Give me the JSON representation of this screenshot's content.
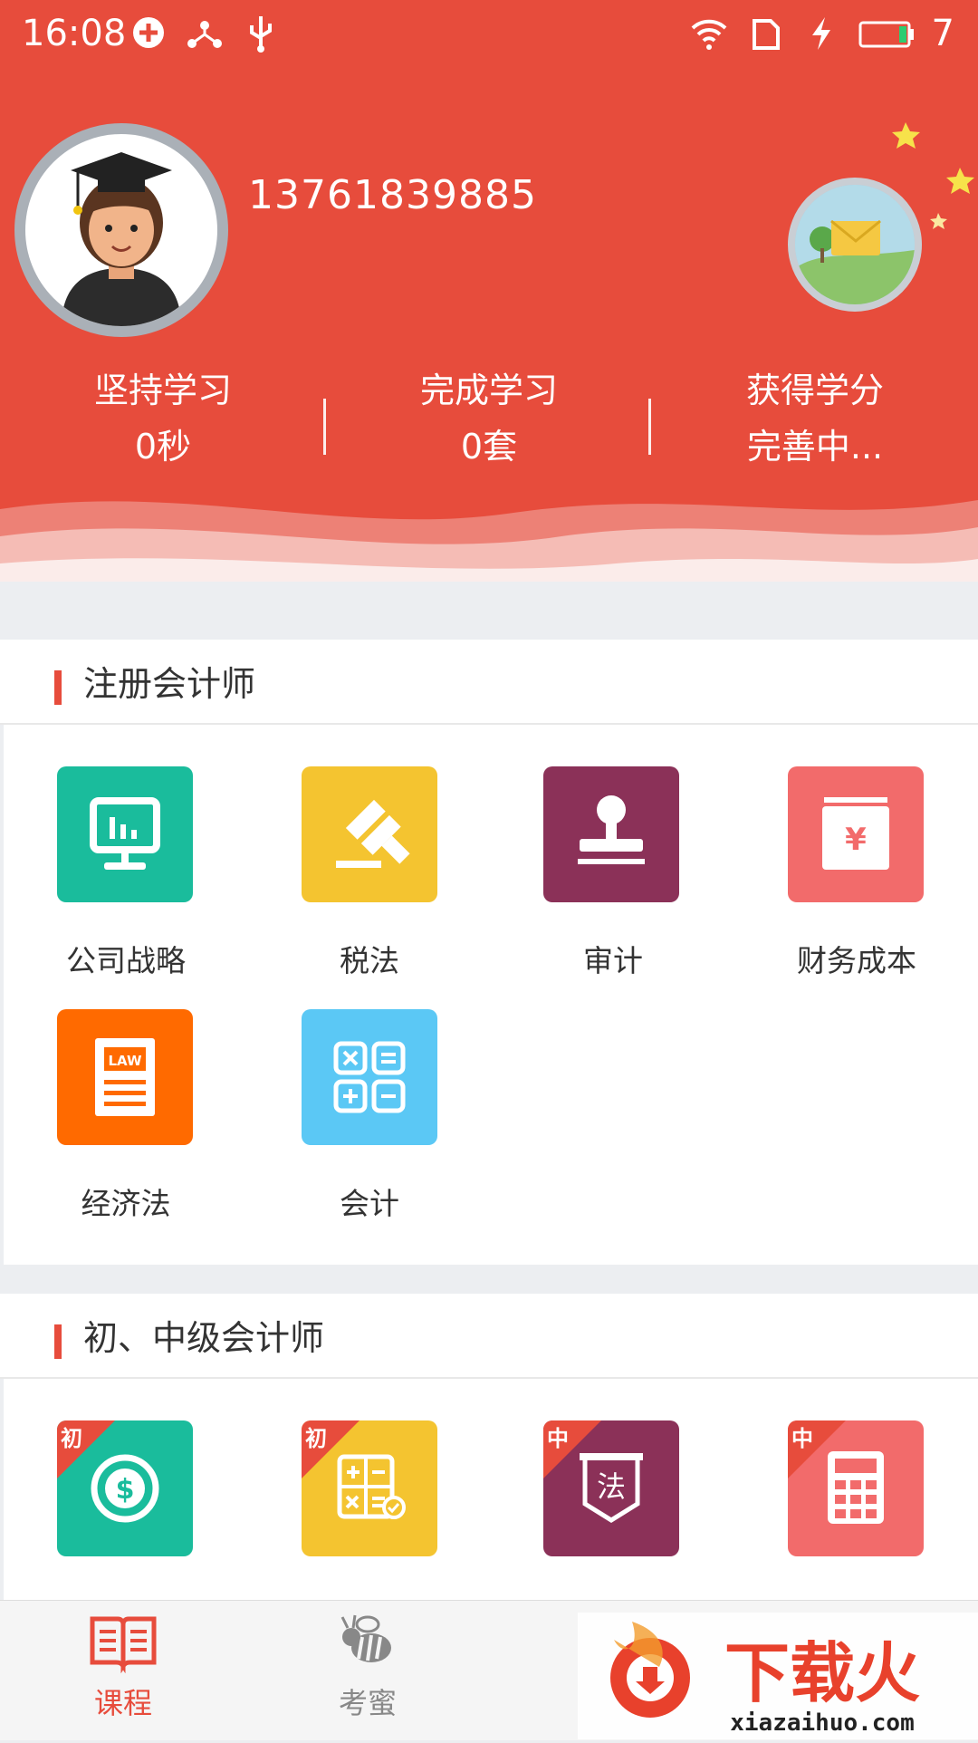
{
  "status_bar": {
    "time": "16:08",
    "battery": "7"
  },
  "profile": {
    "phone": "13761839885"
  },
  "stats": [
    {
      "label": "坚持学习",
      "value": "0秒"
    },
    {
      "label": "完成学习",
      "value": "0套"
    },
    {
      "label": "获得学分",
      "value": "完善中..."
    }
  ],
  "sections": [
    {
      "title": "注册会计师",
      "items": [
        {
          "label": "公司战略",
          "icon": "monitor-chart-icon",
          "color": "#1abc9c"
        },
        {
          "label": "税法",
          "icon": "gavel-icon",
          "color": "#f4c430"
        },
        {
          "label": "审计",
          "icon": "stamp-icon",
          "color": "#8b3158"
        },
        {
          "label": "财务成本",
          "icon": "yen-box-icon",
          "color": "#f26b6b"
        },
        {
          "label": "经济法",
          "icon": "law-document-icon",
          "color": "#ff6a00"
        },
        {
          "label": "会计",
          "icon": "calculator-grid-icon",
          "color": "#5bc8f5"
        }
      ]
    },
    {
      "title": "初、中级会计师",
      "items": [
        {
          "badge": "初",
          "icon": "dollar-coin-icon",
          "color": "#1abc9c"
        },
        {
          "badge": "初",
          "icon": "calc-check-icon",
          "color": "#f4c430"
        },
        {
          "badge": "中",
          "icon": "law-shield-icon",
          "color": "#8b3158"
        },
        {
          "badge": "中",
          "icon": "calculator-icon",
          "color": "#f26b6b"
        }
      ]
    }
  ],
  "tabs": [
    {
      "label": "课程",
      "icon": "book-icon",
      "active": true
    },
    {
      "label": "考蜜",
      "icon": "bee-icon",
      "active": false
    }
  ],
  "watermark": {
    "text": "下载火",
    "url": "xiazaihuo.com"
  },
  "colors": {
    "accent": "#e74c3c"
  }
}
